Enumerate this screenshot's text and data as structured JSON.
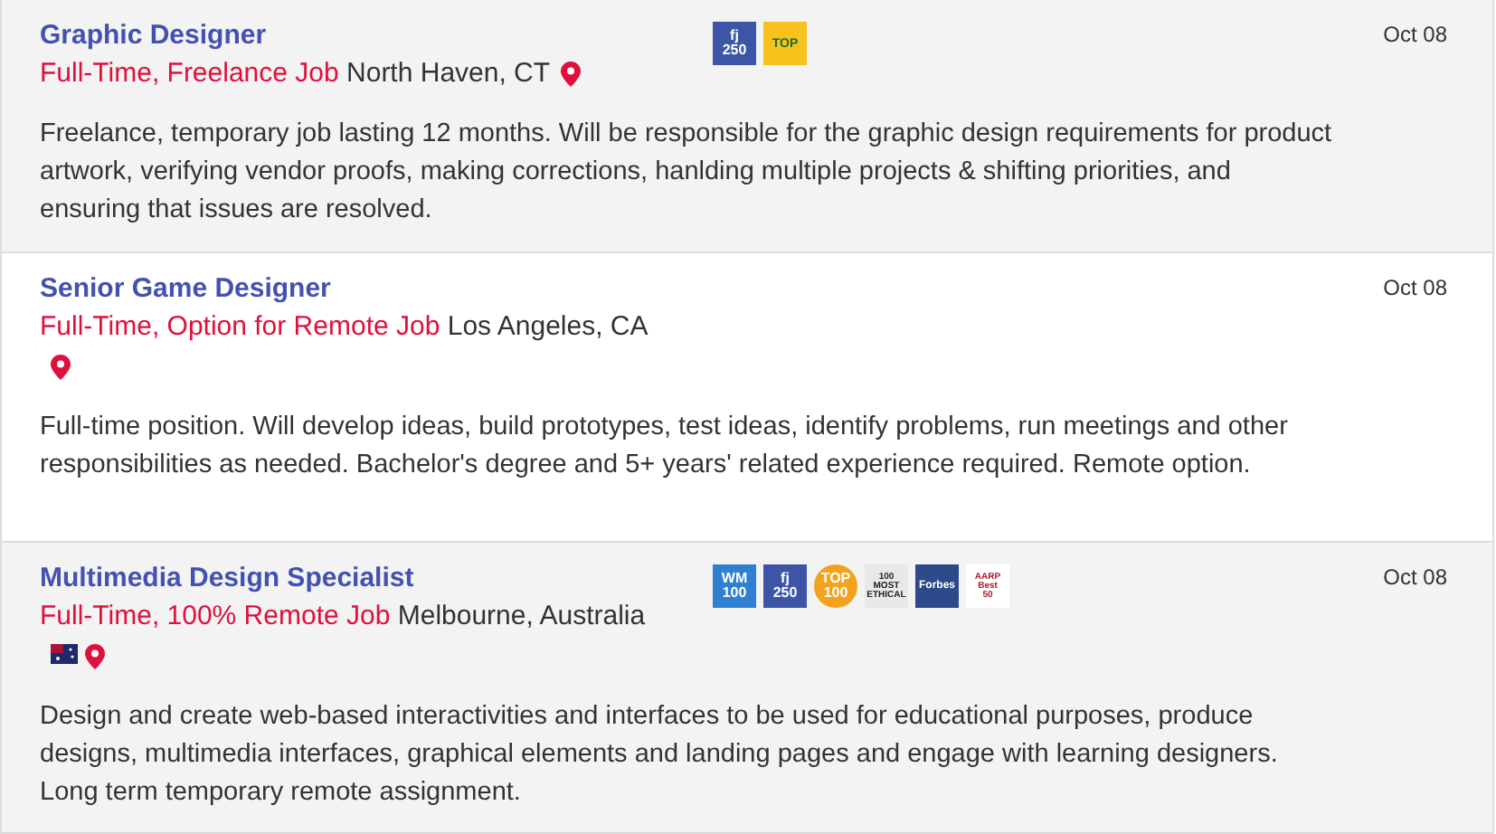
{
  "jobs": [
    {
      "title": "Graphic Designer",
      "job_type": "Full-Time, Freelance Job",
      "location": "North Haven, CT",
      "flag": false,
      "date": "Oct 08",
      "shaded": true,
      "badges": [
        {
          "kind": "fj",
          "lines": [
            "fj",
            "250"
          ]
        },
        {
          "kind": "top",
          "lines": [
            "TOP"
          ]
        }
      ],
      "description": "Freelance, temporary job lasting 12 months. Will be responsible for the graphic design requirements for product artwork, verifying vendor proofs, making corrections, hanlding multiple projects & shifting priorities, and ensuring that issues are resolved."
    },
    {
      "title": "Senior Game Designer",
      "job_type": "Full-Time, Option for Remote Job",
      "location": "Los Angeles, CA",
      "flag": false,
      "date": "Oct 08",
      "shaded": false,
      "description": "Full-time position. Will develop ideas, build prototypes, test ideas, identify problems, run meetings and other responsibilities as needed. Bachelor's degree and 5+ years' related experience required. Remote option."
    },
    {
      "title": "Multimedia Design Specialist",
      "job_type": "Full-Time, 100% Remote Job",
      "location": "Melbourne, Australia",
      "flag": true,
      "date": "Oct 08",
      "shaded": true,
      "badges": [
        {
          "kind": "wm",
          "lines": [
            "WM",
            "100"
          ]
        },
        {
          "kind": "fj",
          "lines": [
            "fj",
            "250"
          ]
        },
        {
          "kind": "seal",
          "lines": [
            "TOP",
            "100"
          ]
        },
        {
          "kind": "ethical",
          "lines": [
            "100",
            "MOST",
            "ETHICAL"
          ]
        },
        {
          "kind": "forbes",
          "lines": [
            "Forbes"
          ]
        },
        {
          "kind": "aarp",
          "lines": [
            "AARP",
            "Best",
            "50"
          ]
        }
      ],
      "description": "Design and create web-based interactivities and interfaces to be used for educational purposes, produce designs, multimedia interfaces, graphical elements and landing pages and engage with learning designers. Long term temporary remote assignment."
    }
  ]
}
